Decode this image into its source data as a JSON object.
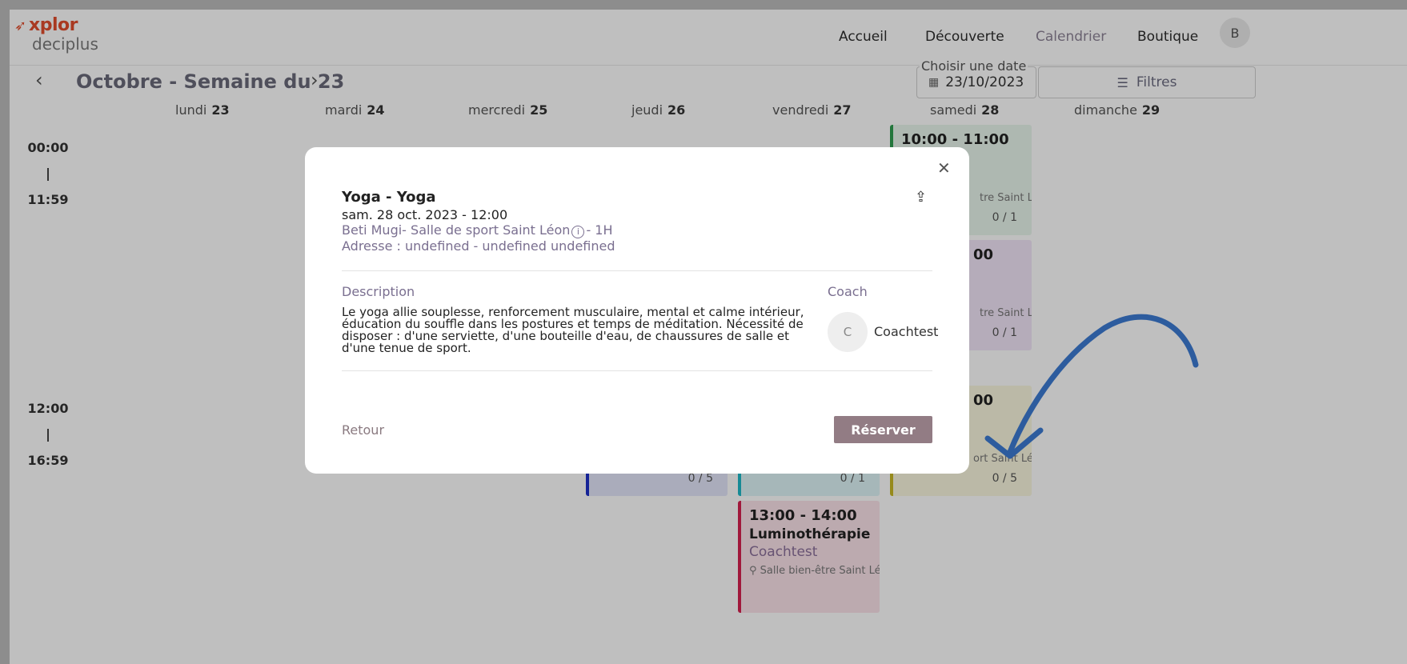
{
  "logo": {
    "top": "xplor",
    "bottom": "deciplus"
  },
  "nav": {
    "items": [
      "Accueil",
      "Découverte",
      "Calendrier",
      "Boutique"
    ],
    "avatar": "B"
  },
  "calendar": {
    "prev_icon": "chevron-left",
    "next_icon": "chevron-right",
    "week_title": "Octobre - Semaine du 23",
    "date_label": "Choisir une date",
    "date_value": "23/10/2023",
    "filters_label": "Filtres",
    "days": [
      {
        "name": "lundi",
        "num": "23"
      },
      {
        "name": "mardi",
        "num": "24"
      },
      {
        "name": "mercredi",
        "num": "25"
      },
      {
        "name": "jeudi",
        "num": "26"
      },
      {
        "name": "vendredi",
        "num": "27"
      },
      {
        "name": "samedi",
        "num": "28"
      },
      {
        "name": "dimanche",
        "num": "29"
      }
    ],
    "slots": [
      {
        "start": "00:00",
        "end": "11:59"
      },
      {
        "start": "12:00",
        "end": "16:59"
      }
    ],
    "events": {
      "sat1": {
        "time": "10:00 - 11:00",
        "loc": "tre Saint Lé",
        "cap": "0 / 1",
        "color": "#2e9e4f",
        "bg": "#e9f6ec"
      },
      "sat2": {
        "time": "00",
        "loc": "tre Saint Lé",
        "cap": "0 / 1",
        "color": "#b36bd6",
        "bg": "#f2e6f8"
      },
      "sat3": {
        "time": "00",
        "loc": "ort Saint Léo",
        "cap": "0 / 5",
        "color": "#c9b824",
        "bg": "#faf7df"
      },
      "thu": {
        "cap": "0 / 5",
        "color": "#1c2fc9",
        "bg": "#e3e6fa"
      },
      "fri": {
        "cap": "0 / 1",
        "color": "#1eb9c7",
        "bg": "#def5f7"
      },
      "fri2": {
        "time": "13:00 - 14:00",
        "title": "Luminothérapie",
        "coach": "Coachtest",
        "loc": "Salle bien-être Saint Lé",
        "color": "#d6214f",
        "bg": "#fbe3ea"
      }
    }
  },
  "modal": {
    "close_icon": "close",
    "share_icon": "share",
    "title": "Yoga - Yoga",
    "datetime": "sam. 28 oct. 2023 - 12:00",
    "place": "Beti Mugi- Salle de sport Saint Léon",
    "info_icon": "i",
    "duration": "- 1H",
    "address": "Adresse : undefined - undefined undefined",
    "description_label": "Description",
    "description": "Le yoga allie souplesse, renforcement musculaire, mental et calme intérieur, éducation du souffle dans les postures et temps de méditation. Nécessité de disposer : d'une serviette, d'une bouteille d'eau, de chaussures de salle et d'une tenue de sport.",
    "coach_label": "Coach",
    "coach_initial": "C",
    "coach_name": "Coachtest",
    "back_label": "Retour",
    "reserve_label": "Réserver"
  }
}
